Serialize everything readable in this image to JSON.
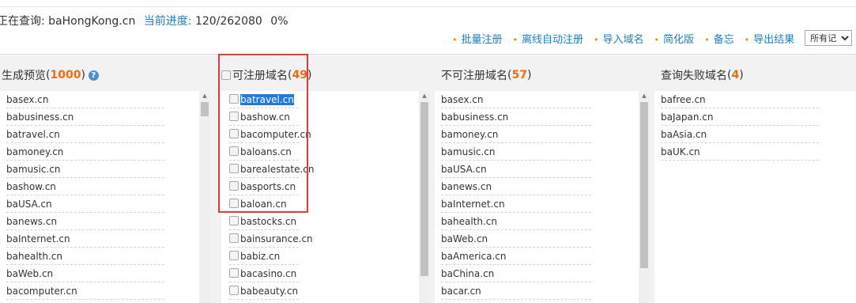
{
  "status": {
    "prefix": "正在查询:",
    "domain": "baHongKong.cn",
    "progress_label": "当前进度:",
    "progress_value": "120/262080",
    "percent": "0%"
  },
  "toolbar": {
    "items": [
      "批量注册",
      "离线自动注册",
      "导入域名",
      "简化版",
      "备忘",
      "导出结果"
    ],
    "select_value": "所有记录"
  },
  "panels": [
    {
      "title": "生成预览",
      "count": "1000",
      "items": [
        "basex.cn",
        "babusiness.cn",
        "batravel.cn",
        "bamoney.cn",
        "bamusic.cn",
        "bashow.cn",
        "baUSA.cn",
        "banews.cn",
        "baInternet.cn",
        "bahealth.cn",
        "baWeb.cn",
        "bacomputer.cn"
      ]
    },
    {
      "title": "可注册域名",
      "count": "49",
      "items": [
        "batravel.cn",
        "bashow.cn",
        "bacomputer.cn",
        "baloans.cn",
        "barealestate.cn",
        "basports.cn",
        "baloan.cn",
        "bastocks.cn",
        "bainsurance.cn",
        "babiz.cn",
        "bacasino.cn",
        "babeauty.cn"
      ]
    },
    {
      "title": "不可注册域名",
      "count": "57",
      "items": [
        "basex.cn",
        "babusiness.cn",
        "bamoney.cn",
        "bamusic.cn",
        "baUSA.cn",
        "banews.cn",
        "baInternet.cn",
        "bahealth.cn",
        "baWeb.cn",
        "baAmerica.cn",
        "baChina.cn",
        "bacar.cn"
      ]
    },
    {
      "title": "查询失败域名",
      "count": "4",
      "items": [
        "bafree.cn",
        "baJapan.cn",
        "baAsia.cn",
        "baUK.cn"
      ]
    }
  ]
}
